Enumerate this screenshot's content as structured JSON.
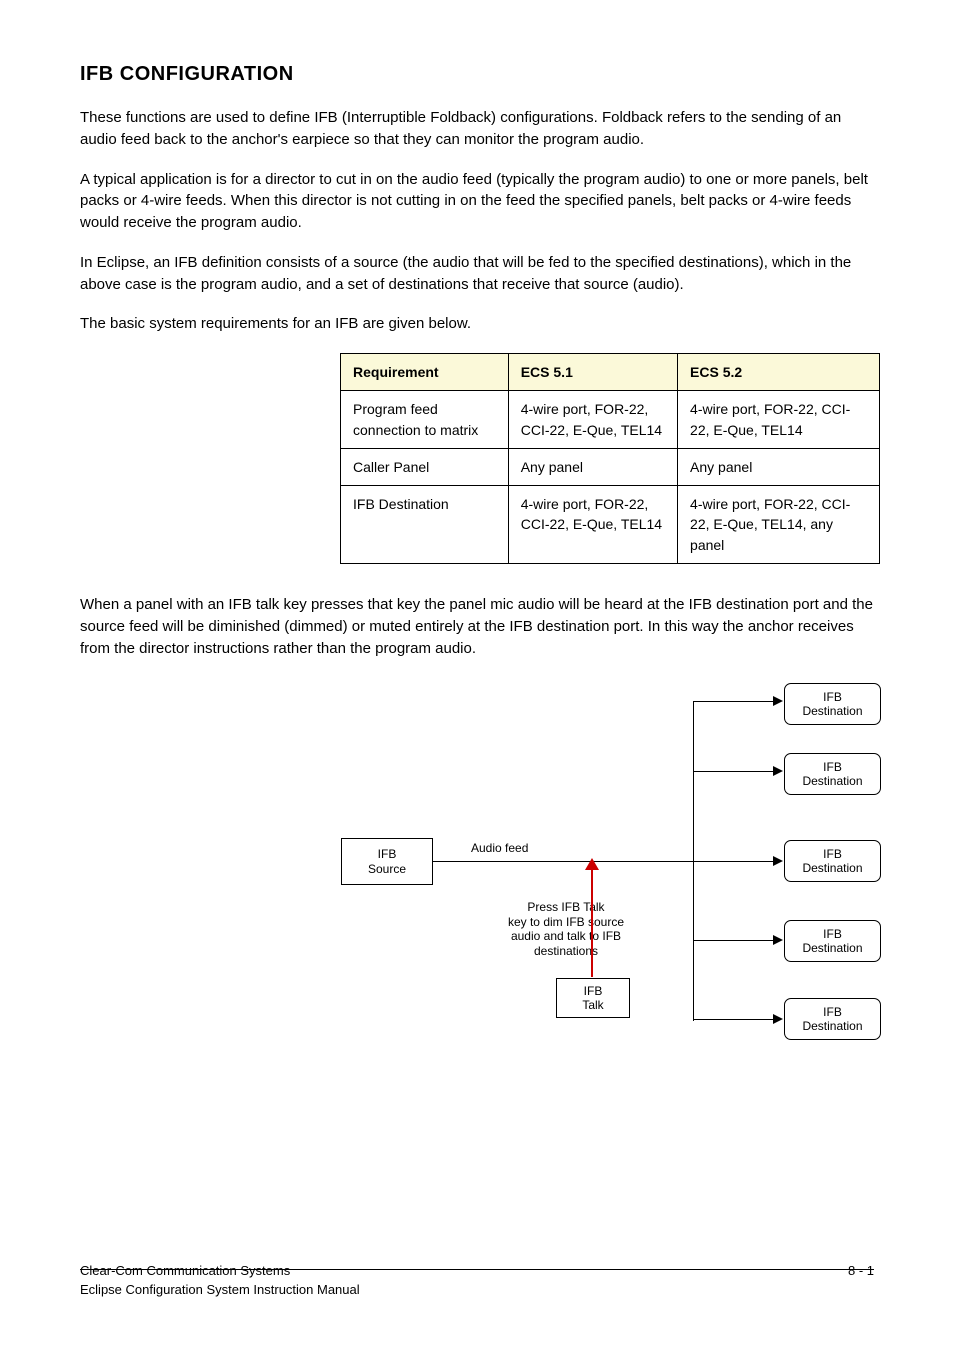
{
  "section_title": "IFB CONFIGURATION",
  "intro_1": "These functions are used to define IFB (Interruptible Foldback) configurations. Foldback refers to the sending of an audio feed back to the anchor's earpiece so that they can monitor the program audio.",
  "intro_2": "A typical application is for a director to cut in on the audio feed (typically the program audio) to one or more panels, belt packs or 4-wire feeds. When this director is not cutting in on the feed the specified panels, belt packs or 4-wire feeds would receive the program audio.",
  "intro_3": "In Eclipse, an IFB definition consists of a source (the audio that will be fed to the specified destinations), which in the above case is the program audio, and a set of destinations that receive that source (audio).",
  "intro_4": "The basic system requirements for an IFB are given below.",
  "table": {
    "headers": [
      "Requirement",
      "ECS 5.1",
      "ECS 5.2"
    ],
    "rows": [
      [
        "Program feed connection to matrix",
        "4-wire port, FOR-22, CCI-22, E-Que, TEL14",
        "4-wire port, FOR-22, CCI-22, E-Que, TEL14"
      ],
      [
        "Caller Panel",
        "Any panel",
        "Any panel"
      ],
      [
        "IFB Destination",
        "4-wire port, FOR-22, CCI-22, E-Que, TEL14",
        "4-wire port, FOR-22, CCI-22, E-Que, TEL14, any panel"
      ]
    ]
  },
  "after_table": "When a panel with an IFB talk key presses that key the panel mic audio will be heard at the IFB destination port and the source feed will be diminished (dimmed) or muted entirely at the IFB destination port. In this way the anchor receives from the director instructions rather than the program audio.",
  "diagram": {
    "src": "IFB\nSource",
    "dest": "IFB\nDestination",
    "audiofeed": "Audio feed",
    "pressnote": "Press IFB Talk\nkey to dim IFB source\naudio and talk to IFB\ndestinations",
    "talkbox": "IFB\nTalk"
  },
  "footer_left": "Clear-Com Communication Systems",
  "footer_center": "Eclipse Configuration System Instruction Manual",
  "footer_page": "8 - 1"
}
